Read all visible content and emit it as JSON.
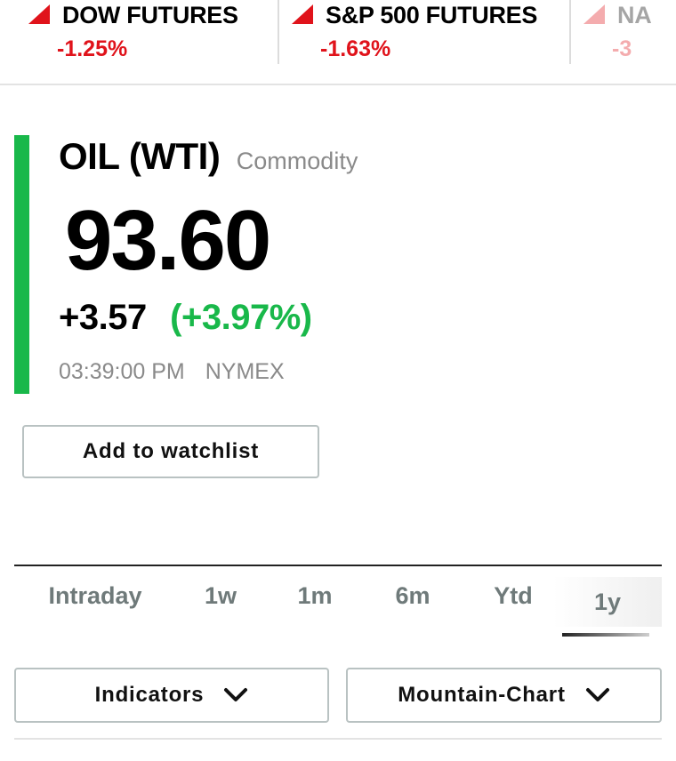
{
  "ticker": {
    "items": [
      {
        "name": "DOW FUTURES",
        "change": "-1.25%",
        "direction": "down"
      },
      {
        "name": "S&P 500 FUTURES",
        "change": "-1.63%",
        "direction": "down"
      },
      {
        "name": "NA",
        "change": "-3",
        "direction": "down"
      }
    ]
  },
  "quote": {
    "name": "OIL (WTI)",
    "type": "Commodity",
    "price": "93.60",
    "change": "+3.57",
    "change_pct": "(+3.97%)",
    "time": "03:39:00 PM",
    "exchange": "NYMEX"
  },
  "watchlist_button": "Add to watchlist",
  "timeframes": {
    "tabs": [
      "Intraday",
      "1w",
      "1m",
      "6m",
      "Ytd",
      "1y"
    ],
    "selected": "1y"
  },
  "controls": {
    "indicators_label": "Indicators",
    "chart_type_label": "Mountain-Chart"
  },
  "colors": {
    "down": "#e0131b",
    "up": "#19b84a",
    "accent_bar": "#19b84a"
  }
}
